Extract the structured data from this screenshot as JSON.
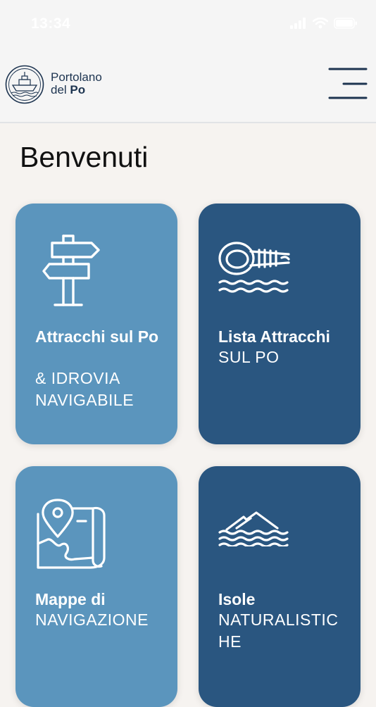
{
  "status_bar": {
    "time": "13:34"
  },
  "header": {
    "brand_line1": "Portolano",
    "brand_line2_a": "del ",
    "brand_line2_b": "Po"
  },
  "page": {
    "title": "Benvenuti"
  },
  "cards": [
    {
      "title": "Attracchi sul Po",
      "subtitle": "& IDROVIA NAVIGABILE",
      "icon": "signpost-icon"
    },
    {
      "title": "Lista Attracchi",
      "subtitle": "SUL PO",
      "icon": "rope-knot-icon"
    },
    {
      "title": "Mappe di",
      "subtitle": "NAVIGAZIONE",
      "icon": "map-pin-icon"
    },
    {
      "title": "Isole",
      "subtitle": "NATURALISTICHE",
      "icon": "island-icon"
    }
  ],
  "colors": {
    "card_light": "#5b95bd",
    "card_dark": "#2a5680",
    "brand": "#1d3450",
    "background": "#f6f3f0"
  }
}
